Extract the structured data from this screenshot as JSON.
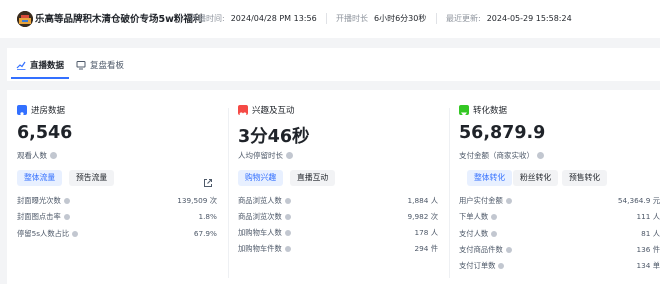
{
  "header": {
    "title": "乐高等品牌积木清仓破价专场5w粉福利",
    "start_label": "开播时间:",
    "start_value": "2024/04/28 PM 13:56",
    "duration_label": "开播时长",
    "duration_value": "6小时6分30秒",
    "updated_label": "最近更新:",
    "updated_value": "2024-05-29 15:58:24"
  },
  "tabs": [
    {
      "label": "直播数据",
      "icon": "trend-icon"
    },
    {
      "label": "复盘看板",
      "icon": "monitor-icon"
    }
  ],
  "colors": {
    "accent": "#3370ff",
    "entry": "#3370ff",
    "interaction": "#f54a45",
    "conversion": "#34c724"
  },
  "entry": {
    "title": "进房数据",
    "value": "6,546",
    "metric": "观看人数",
    "pills": [
      "整体流量",
      "预告流量"
    ],
    "rows": [
      {
        "label": "封面曝光次数",
        "value": "139,509 次"
      },
      {
        "label": "封面图点击率",
        "value": "1.8%"
      },
      {
        "label": "停留5s人数占比",
        "value": "67.9%"
      }
    ]
  },
  "interaction": {
    "title": "兴趣及互动",
    "value": "3分46秒",
    "metric": "人均停留时长",
    "pills": [
      "购物兴趣",
      "直播互动"
    ],
    "rows": [
      {
        "label": "商品浏览人数",
        "value": "1,884 人"
      },
      {
        "label": "商品浏览次数",
        "value": "9,982 次"
      },
      {
        "label": "加购物车人数",
        "value": "178 人"
      },
      {
        "label": "加购物车件数",
        "value": "294 件"
      }
    ]
  },
  "conversion": {
    "title": "转化数据",
    "value": "56,879.9",
    "metric": "支付金额（商家实收）",
    "pills": [
      "整体转化",
      "粉丝转化",
      "预售转化"
    ],
    "rows": [
      {
        "label": "用户实付金额",
        "value": "54,364.9 元"
      },
      {
        "label": "下单人数",
        "value": "111 人"
      },
      {
        "label": "支付人数",
        "value": "81 人"
      },
      {
        "label": "支付商品件数",
        "value": "136 件"
      },
      {
        "label": "支付订单数",
        "value": "134 单"
      }
    ]
  }
}
